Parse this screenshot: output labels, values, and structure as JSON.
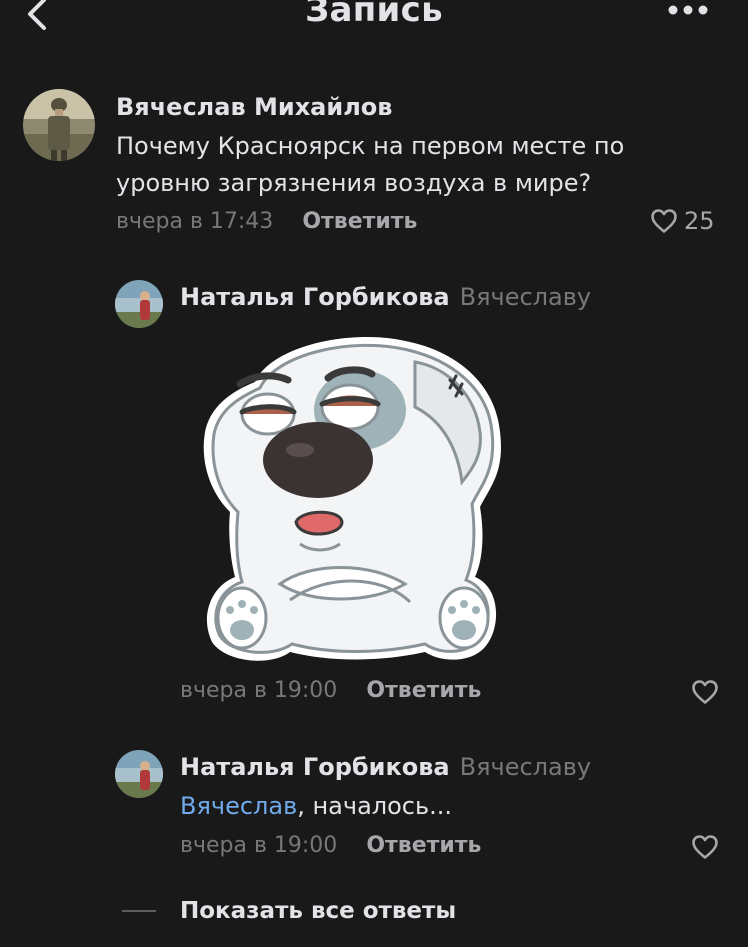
{
  "header": {
    "title": "Запись"
  },
  "comments": [
    {
      "author": "Вячеслав Михайлов",
      "text": "Почему Красноярск на первом месте по уровню загрязнения воздуха в мире?",
      "time": "вчера в 17:43",
      "reply_label": "Ответить",
      "likes": "25"
    },
    {
      "author": "Наталья Горбикова",
      "reply_to": "Вячеславу",
      "sticker": "dog-sticker",
      "time": "вчера в 19:00",
      "reply_label": "Ответить"
    },
    {
      "author": "Наталья Горбикова",
      "reply_to": "Вячеславу",
      "mention": "Вячеслав",
      "text": ", началось...",
      "time": "вчера в 19:00",
      "reply_label": "Ответить"
    }
  ],
  "show_all_replies": "Показать все ответы",
  "icons": {
    "back": "chevron-left-icon",
    "more": "more-horizontal-icon",
    "like": "heart-outline-icon"
  },
  "colors": {
    "background": "#19191a",
    "text_primary": "#e1e3e6",
    "text_secondary": "#76787a",
    "link": "#71aaeb"
  }
}
